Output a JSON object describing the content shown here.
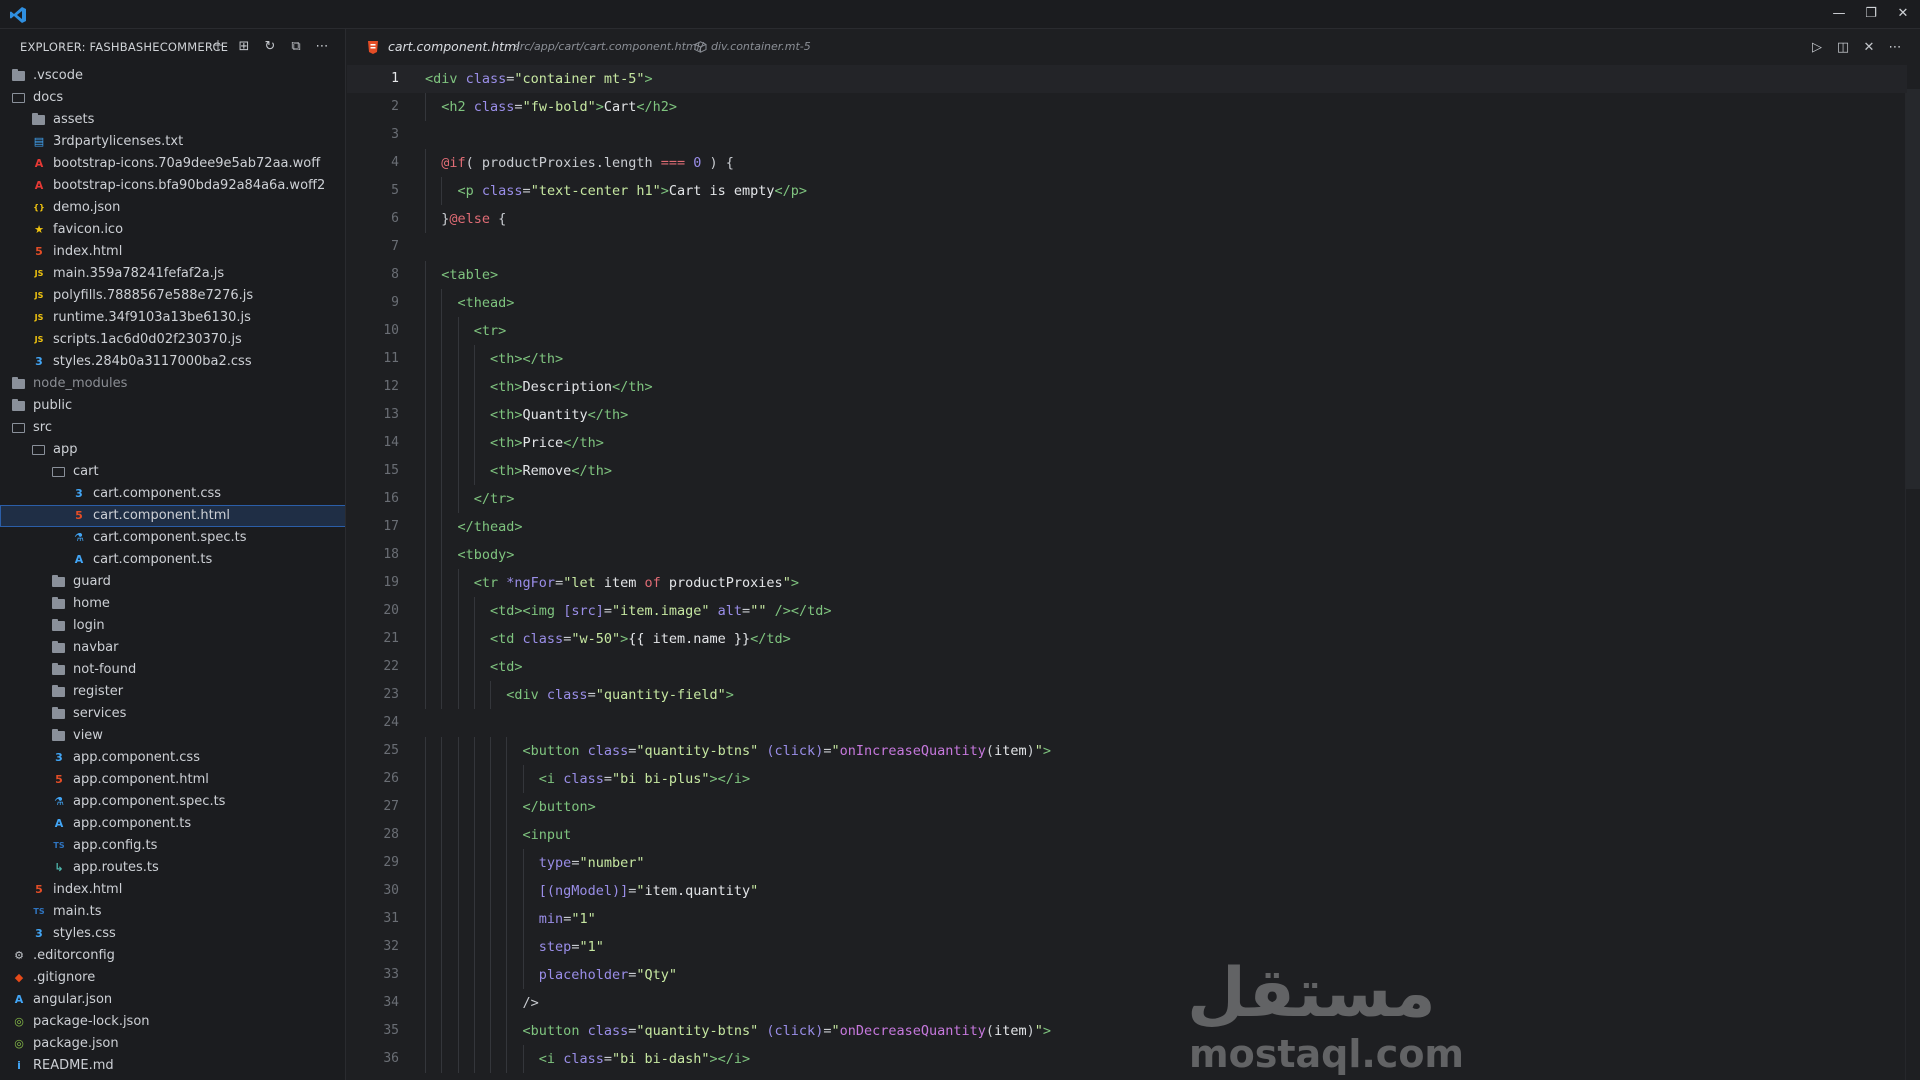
{
  "explorer": {
    "title": "EXPLORER: FASHBASHECOMMERCE",
    "actions": [
      {
        "name": "new-file-icon",
        "glyph": "＋"
      },
      {
        "name": "new-folder-icon",
        "glyph": "⊞"
      },
      {
        "name": "refresh-icon",
        "glyph": "↻"
      },
      {
        "name": "collapse-all-icon",
        "glyph": "⧉"
      },
      {
        "name": "more-actions-icon",
        "glyph": "⋯"
      }
    ],
    "tree": [
      {
        "label": ".vscode",
        "kind": "folder",
        "depth": 0
      },
      {
        "label": "docs",
        "kind": "folder-open",
        "depth": 0
      },
      {
        "label": "assets",
        "kind": "folder",
        "depth": 1
      },
      {
        "label": "3rdpartylicenses.txt",
        "kind": "txt",
        "depth": 1
      },
      {
        "label": "bootstrap-icons.70a9dee9e5ab72aa.woff",
        "kind": "font",
        "depth": 1
      },
      {
        "label": "bootstrap-icons.bfa90bda92a84a6a.woff2",
        "kind": "font",
        "depth": 1
      },
      {
        "label": "demo.json",
        "kind": "json",
        "depth": 1
      },
      {
        "label": "favicon.ico",
        "kind": "star",
        "depth": 1
      },
      {
        "label": "index.html",
        "kind": "html",
        "depth": 1
      },
      {
        "label": "main.359a78241fefaf2a.js",
        "kind": "js",
        "depth": 1
      },
      {
        "label": "polyfills.7888567e588e7276.js",
        "kind": "js",
        "depth": 1
      },
      {
        "label": "runtime.34f9103a13be6130.js",
        "kind": "js",
        "depth": 1
      },
      {
        "label": "scripts.1ac6d0d02f230370.js",
        "kind": "js",
        "depth": 1
      },
      {
        "label": "styles.284b0a3117000ba2.css",
        "kind": "css",
        "depth": 1
      },
      {
        "label": "node_modules",
        "kind": "folder",
        "depth": 0,
        "dim": true
      },
      {
        "label": "public",
        "kind": "folder",
        "depth": 0
      },
      {
        "label": "src",
        "kind": "folder-open",
        "depth": 0
      },
      {
        "label": "app",
        "kind": "folder-open",
        "depth": 1
      },
      {
        "label": "cart",
        "kind": "folder-open",
        "depth": 2
      },
      {
        "label": "cart.component.css",
        "kind": "css",
        "depth": 3
      },
      {
        "label": "cart.component.html",
        "kind": "html",
        "depth": 3,
        "selected": true
      },
      {
        "label": "cart.component.spec.ts",
        "kind": "spec",
        "depth": 3
      },
      {
        "label": "cart.component.ts",
        "kind": "angular",
        "depth": 3
      },
      {
        "label": "guard",
        "kind": "folder",
        "depth": 2
      },
      {
        "label": "home",
        "kind": "folder",
        "depth": 2
      },
      {
        "label": "login",
        "kind": "folder",
        "depth": 2
      },
      {
        "label": "navbar",
        "kind": "folder",
        "depth": 2
      },
      {
        "label": "not-found",
        "kind": "folder",
        "depth": 2
      },
      {
        "label": "register",
        "kind": "folder",
        "depth": 2
      },
      {
        "label": "services",
        "kind": "folder",
        "depth": 2
      },
      {
        "label": "view",
        "kind": "folder",
        "depth": 2
      },
      {
        "label": "app.component.css",
        "kind": "css",
        "depth": 2
      },
      {
        "label": "app.component.html",
        "kind": "html",
        "depth": 2
      },
      {
        "label": "app.component.spec.ts",
        "kind": "spec",
        "depth": 2
      },
      {
        "label": "app.component.ts",
        "kind": "angular",
        "depth": 2
      },
      {
        "label": "app.config.ts",
        "kind": "ts",
        "depth": 2
      },
      {
        "label": "app.routes.ts",
        "kind": "routes",
        "depth": 2
      },
      {
        "label": "index.html",
        "kind": "html",
        "depth": 1
      },
      {
        "label": "main.ts",
        "kind": "ts",
        "depth": 1
      },
      {
        "label": "styles.css",
        "kind": "css",
        "depth": 1
      },
      {
        "label": ".editorconfig",
        "kind": "config",
        "depth": 0
      },
      {
        "label": ".gitignore",
        "kind": "git",
        "depth": 0
      },
      {
        "label": "angular.json",
        "kind": "angular",
        "depth": 0
      },
      {
        "label": "package-lock.json",
        "kind": "npm",
        "depth": 0
      },
      {
        "label": "package.json",
        "kind": "npm",
        "depth": 0
      },
      {
        "label": "README.md",
        "kind": "info",
        "depth": 0
      }
    ]
  },
  "editor": {
    "file": "cart.component.html",
    "path": "src/app/cart/cart.component.html/",
    "symbol": "div.container.mt-5",
    "active_line": 1,
    "actions": [
      {
        "name": "run-icon",
        "glyph": "▷"
      },
      {
        "name": "split-editor-icon",
        "glyph": "◫"
      },
      {
        "name": "close-icon",
        "glyph": "✕"
      },
      {
        "name": "more-editor-actions-icon",
        "glyph": "⋯"
      }
    ],
    "lines": [
      [
        [
          "tag",
          "<div "
        ],
        [
          "attr",
          "class"
        ],
        [
          "punc",
          "="
        ],
        [
          "str",
          "\"container mt-5\""
        ],
        [
          "tag",
          ">"
        ]
      ],
      [
        [
          "sp",
          "  "
        ],
        [
          "tag",
          "<h2 "
        ],
        [
          "attr",
          "class"
        ],
        [
          "punc",
          "="
        ],
        [
          "str",
          "\"fw-bold\""
        ],
        [
          "tag",
          ">"
        ],
        [
          "txt",
          "Cart"
        ],
        [
          "tag",
          "</h2>"
        ]
      ],
      [],
      [
        [
          "sp",
          "  "
        ],
        [
          "kw",
          "@if"
        ],
        [
          "punc",
          "( productProxies.length "
        ],
        [
          "op",
          "==="
        ],
        [
          "punc",
          " "
        ],
        [
          "num",
          "0"
        ],
        [
          "punc",
          " ) {"
        ]
      ],
      [
        [
          "sp",
          "    "
        ],
        [
          "tag",
          "<p "
        ],
        [
          "attr",
          "class"
        ],
        [
          "punc",
          "="
        ],
        [
          "str",
          "\"text-center h1\""
        ],
        [
          "tag",
          ">"
        ],
        [
          "txt",
          "Cart is empty"
        ],
        [
          "tag",
          "</p>"
        ]
      ],
      [
        [
          "sp",
          "  "
        ],
        [
          "punc",
          "}"
        ],
        [
          "kw",
          "@else"
        ],
        [
          "punc",
          " {"
        ]
      ],
      [],
      [
        [
          "sp",
          "  "
        ],
        [
          "tag",
          "<table>"
        ]
      ],
      [
        [
          "sp",
          "    "
        ],
        [
          "tag",
          "<thead>"
        ]
      ],
      [
        [
          "sp",
          "      "
        ],
        [
          "tag",
          "<tr>"
        ]
      ],
      [
        [
          "sp",
          "        "
        ],
        [
          "tag",
          "<th></th>"
        ]
      ],
      [
        [
          "sp",
          "        "
        ],
        [
          "tag",
          "<th>"
        ],
        [
          "txt",
          "Description"
        ],
        [
          "tag",
          "</th>"
        ]
      ],
      [
        [
          "sp",
          "        "
        ],
        [
          "tag",
          "<th>"
        ],
        [
          "txt",
          "Quantity"
        ],
        [
          "tag",
          "</th>"
        ]
      ],
      [
        [
          "sp",
          "        "
        ],
        [
          "tag",
          "<th>"
        ],
        [
          "txt",
          "Price"
        ],
        [
          "tag",
          "</th>"
        ]
      ],
      [
        [
          "sp",
          "        "
        ],
        [
          "tag",
          "<th>"
        ],
        [
          "txt",
          "Remove"
        ],
        [
          "tag",
          "</th>"
        ]
      ],
      [
        [
          "sp",
          "      "
        ],
        [
          "tag",
          "</tr>"
        ]
      ],
      [
        [
          "sp",
          "    "
        ],
        [
          "tag",
          "</thead>"
        ]
      ],
      [
        [
          "sp",
          "    "
        ],
        [
          "tag",
          "<tbody>"
        ]
      ],
      [
        [
          "sp",
          "      "
        ],
        [
          "tag",
          "<tr "
        ],
        [
          "attr",
          "*ngFor"
        ],
        [
          "punc",
          "="
        ],
        [
          "str",
          "\"let "
        ],
        [
          "txt",
          "item "
        ],
        [
          "kw",
          "of "
        ],
        [
          "txt",
          "productProxies"
        ],
        [
          "str",
          "\""
        ],
        [
          "tag",
          ">"
        ]
      ],
      [
        [
          "sp",
          "        "
        ],
        [
          "tag",
          "<td><img "
        ],
        [
          "attr",
          "[src]"
        ],
        [
          "punc",
          "="
        ],
        [
          "str",
          "\"item.image\""
        ],
        [
          "punc",
          " "
        ],
        [
          "attr",
          "alt"
        ],
        [
          "punc",
          "="
        ],
        [
          "str",
          "\"\""
        ],
        [
          "punc",
          " "
        ],
        [
          "tag",
          "/></td>"
        ]
      ],
      [
        [
          "sp",
          "        "
        ],
        [
          "tag",
          "<td "
        ],
        [
          "attr",
          "class"
        ],
        [
          "punc",
          "="
        ],
        [
          "str",
          "\"w-50\""
        ],
        [
          "tag",
          ">"
        ],
        [
          "txt",
          "{{ item.name }}"
        ],
        [
          "tag",
          "</td>"
        ]
      ],
      [
        [
          "sp",
          "        "
        ],
        [
          "tag",
          "<td>"
        ]
      ],
      [
        [
          "sp",
          "          "
        ],
        [
          "tag",
          "<div "
        ],
        [
          "attr",
          "class"
        ],
        [
          "punc",
          "="
        ],
        [
          "str",
          "\"quantity-field\""
        ],
        [
          "tag",
          ">"
        ]
      ],
      [],
      [
        [
          "sp",
          "            "
        ],
        [
          "tag",
          "<button "
        ],
        [
          "attr",
          "class"
        ],
        [
          "punc",
          "="
        ],
        [
          "str",
          "\"quantity-btns\""
        ],
        [
          "punc",
          " "
        ],
        [
          "attr",
          "(click)"
        ],
        [
          "punc",
          "="
        ],
        [
          "str",
          "\""
        ],
        [
          "fn",
          "onIncreaseQuantity"
        ],
        [
          "punc",
          "("
        ],
        [
          "txt",
          "item"
        ],
        [
          "punc",
          ")"
        ],
        [
          "str",
          "\""
        ],
        [
          "tag",
          ">"
        ]
      ],
      [
        [
          "sp",
          "              "
        ],
        [
          "tag",
          "<i "
        ],
        [
          "attr",
          "class"
        ],
        [
          "punc",
          "="
        ],
        [
          "str",
          "\"bi bi-plus\""
        ],
        [
          "tag",
          "></i>"
        ]
      ],
      [
        [
          "sp",
          "            "
        ],
        [
          "tag",
          "</button>"
        ]
      ],
      [
        [
          "sp",
          "            "
        ],
        [
          "tag",
          "<input"
        ]
      ],
      [
        [
          "sp",
          "              "
        ],
        [
          "attr",
          "type"
        ],
        [
          "punc",
          "="
        ],
        [
          "str",
          "\"number\""
        ]
      ],
      [
        [
          "sp",
          "              "
        ],
        [
          "attr",
          "[(ngModel)]"
        ],
        [
          "punc",
          "="
        ],
        [
          "str",
          "\""
        ],
        [
          "txt",
          "item.quantity"
        ],
        [
          "str",
          "\""
        ]
      ],
      [
        [
          "sp",
          "              "
        ],
        [
          "attr",
          "min"
        ],
        [
          "punc",
          "="
        ],
        [
          "str",
          "\"1\""
        ]
      ],
      [
        [
          "sp",
          "              "
        ],
        [
          "attr",
          "step"
        ],
        [
          "punc",
          "="
        ],
        [
          "str",
          "\"1\""
        ]
      ],
      [
        [
          "sp",
          "              "
        ],
        [
          "attr",
          "placeholder"
        ],
        [
          "punc",
          "="
        ],
        [
          "str",
          "\"Qty\""
        ]
      ],
      [
        [
          "sp",
          "            "
        ],
        [
          "punc",
          "/>"
        ]
      ],
      [
        [
          "sp",
          "            "
        ],
        [
          "tag",
          "<button "
        ],
        [
          "attr",
          "class"
        ],
        [
          "punc",
          "="
        ],
        [
          "str",
          "\"quantity-btns\""
        ],
        [
          "punc",
          " "
        ],
        [
          "attr",
          "(click)"
        ],
        [
          "punc",
          "="
        ],
        [
          "str",
          "\""
        ],
        [
          "fn",
          "onDecreaseQuantity"
        ],
        [
          "punc",
          "("
        ],
        [
          "txt",
          "item"
        ],
        [
          "punc",
          ")"
        ],
        [
          "str",
          "\""
        ],
        [
          "tag",
          ">"
        ]
      ],
      [
        [
          "sp",
          "              "
        ],
        [
          "tag",
          "<i "
        ],
        [
          "attr",
          "class"
        ],
        [
          "punc",
          "="
        ],
        [
          "str",
          "\"bi bi-dash\""
        ],
        [
          "tag",
          "></i>"
        ]
      ]
    ]
  },
  "watermark": {
    "arabic": "مستقل",
    "latin": "mostaql.com"
  },
  "window": {
    "minimize_glyph": "—",
    "restore_glyph": "❐",
    "close_glyph": "✕"
  },
  "colors": {
    "accent": "#2b5ea8",
    "html_icon": "#e44d26",
    "css_icon": "#42a5f5",
    "js_icon": "#f1c40f",
    "angular_icon": "#42a5f5",
    "json_icon": "#f1c40f",
    "npm_icon": "#8bc34a",
    "git_icon": "#e64a19"
  }
}
